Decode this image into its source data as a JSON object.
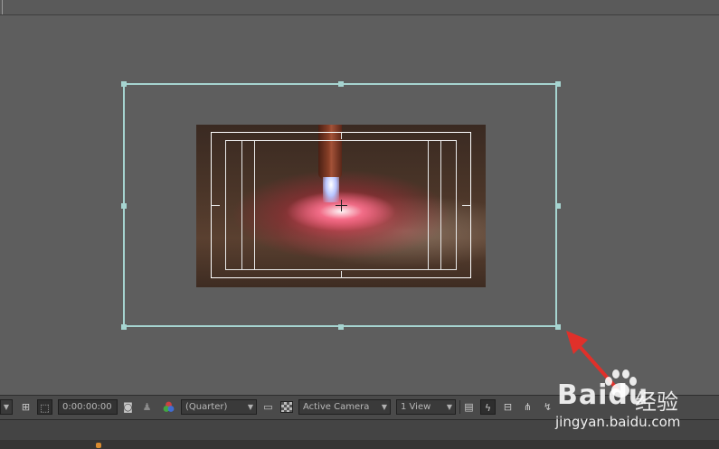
{
  "toolbar": {
    "timecode": "0:00:00:00",
    "resolution": "(Quarter)",
    "camera": "Active Camera",
    "views": "1 View"
  },
  "watermark": {
    "brand": "Baidu",
    "brand_cn": "经验",
    "url": "jingyan.baidu.com"
  },
  "icons": {
    "snapshot": "camera-icon",
    "show_snapshot": "person-icon",
    "channels": "rgb-circles-icon",
    "region": "region-icon",
    "transparency": "checkerboard-icon",
    "fast_preview": "lightning-icon",
    "timeline": "timeline-icon",
    "flowchart": "flowchart-icon"
  },
  "colors": {
    "bounding_box": "#a6d4d0",
    "arrow": "#e0302a",
    "panel_bg": "#5e5e5e"
  }
}
